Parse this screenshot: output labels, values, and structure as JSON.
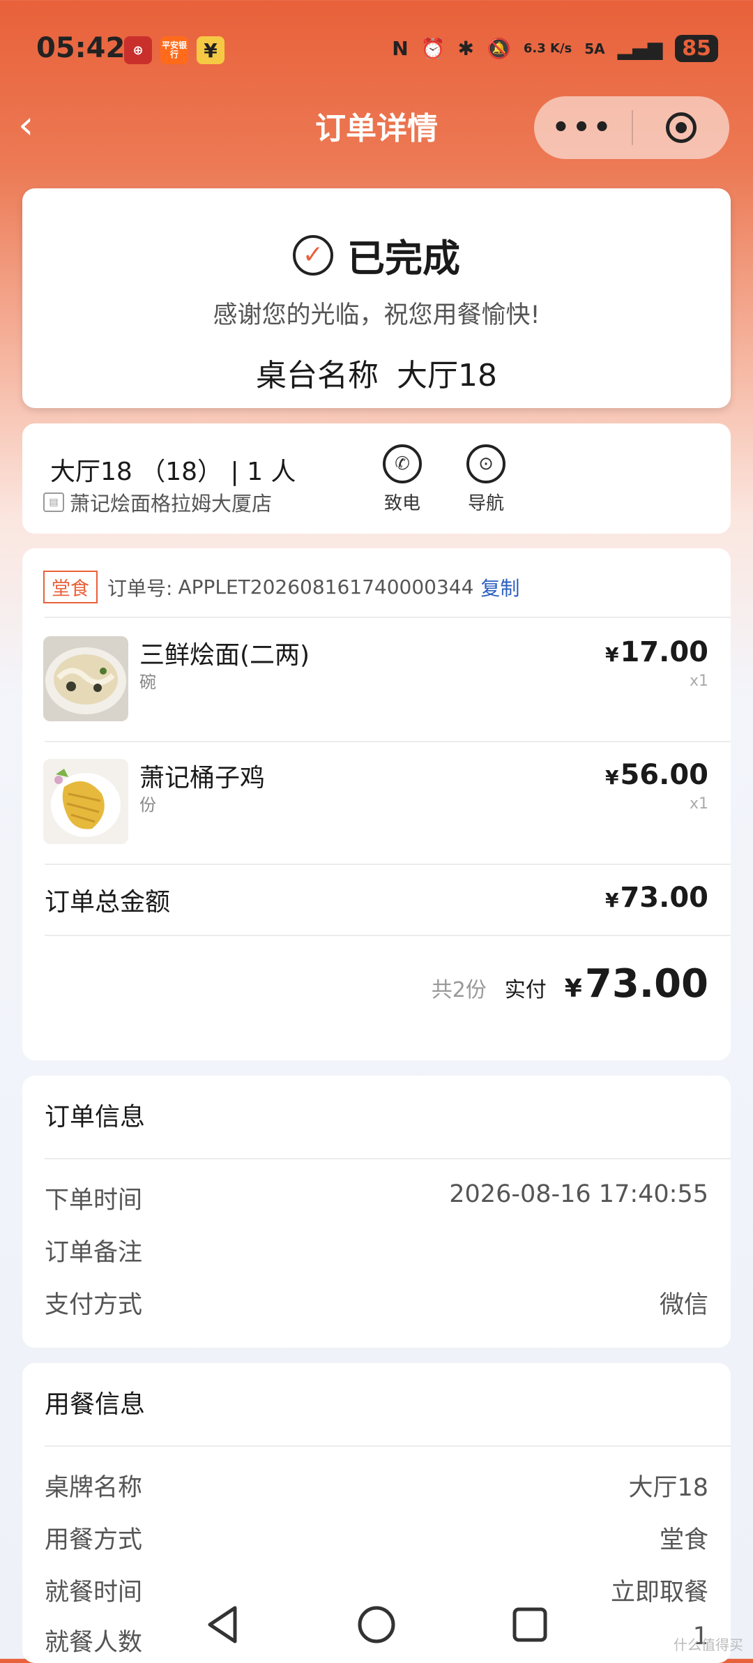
{
  "status_bar": {
    "time": "05:42",
    "app_icons": [
      "bank-icon",
      "pingan-bank-icon",
      "yen-icon"
    ],
    "app_icon_labels": [
      "",
      "平安银行",
      "¥"
    ],
    "net_speed": "6.3 K/s",
    "network": "5A",
    "battery": "85"
  },
  "nav": {
    "back_icon": "chevron-left-icon",
    "title": "订单详情",
    "more_label": "•••"
  },
  "status_card": {
    "status": "已完成",
    "thanks": "感谢您的光临，祝您用餐愉快!",
    "table_label": "桌台名称",
    "table_value": "大厅18"
  },
  "store_card": {
    "table_line": "大厅18 （18） | 1 人",
    "store_name": "萧记烩面格拉姆大厦店",
    "actions": [
      {
        "label": "致电",
        "icon": "phone-icon"
      },
      {
        "label": "导航",
        "icon": "location-pin-icon"
      }
    ]
  },
  "order": {
    "tag": "堂食",
    "order_no_label": "订单号:",
    "order_no": "APPLET202608161740000344",
    "copy_label": "复制",
    "items": [
      {
        "name": "三鲜烩面(二两)",
        "unit": "碗",
        "price": "17.00",
        "qty": "x1"
      },
      {
        "name": "萧记桶子鸡",
        "unit": "份",
        "price": "56.00",
        "qty": "x1"
      }
    ],
    "currency": "¥",
    "total_label": "订单总金额",
    "total": "73.00",
    "count": "共2份",
    "paid_label": "实付",
    "paid": "73.00"
  },
  "order_info": {
    "title": "订单信息",
    "rows": [
      {
        "label": "下单时间",
        "value": "2026-08-16 17:40:55"
      },
      {
        "label": "订单备注",
        "value": ""
      },
      {
        "label": "支付方式",
        "value": "微信"
      }
    ]
  },
  "dine_info": {
    "title": "用餐信息",
    "rows": [
      {
        "label": "桌牌名称",
        "value": "大厅18"
      },
      {
        "label": "用餐方式",
        "value": "堂食"
      },
      {
        "label": "就餐时间",
        "value": "立即取餐"
      },
      {
        "label": "就餐人数",
        "value": "1"
      }
    ]
  },
  "watermark": "什么值得买",
  "colors": {
    "accent": "#e8613a",
    "link": "#2b5fbf"
  }
}
